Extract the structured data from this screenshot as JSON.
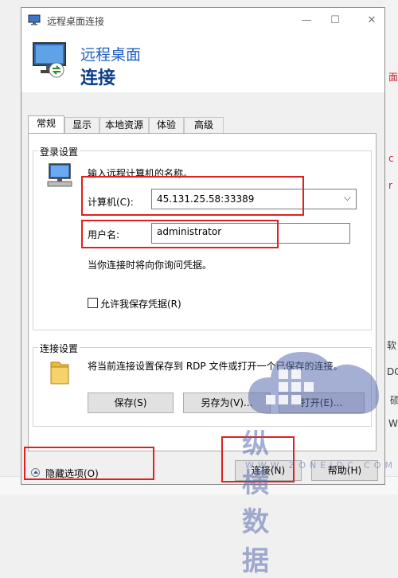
{
  "window": {
    "title": "远程桌面连接",
    "controls": {
      "minimize": "—",
      "maximize": "☐",
      "close": "✕"
    }
  },
  "header": {
    "line1": "远程桌面",
    "line2": "连接"
  },
  "tabs": [
    {
      "label": "常规",
      "active": true
    },
    {
      "label": "显示"
    },
    {
      "label": "本地资源"
    },
    {
      "label": "体验"
    },
    {
      "label": "高级"
    }
  ],
  "logon": {
    "group_title": "登录设置",
    "instruction": "输入远程计算机的名称。",
    "computer_label": "计算机(C):",
    "computer_value": "45.131.25.58:33389",
    "username_label": "用户名:",
    "username_value": "administrator",
    "prompt_note": "当你连接时将向你询问凭据。",
    "save_credentials_label": "允许我保存凭据(R)",
    "save_credentials_checked": false
  },
  "connection": {
    "group_title": "连接设置",
    "description": "将当前连接设置保存到 RDP 文件或打开一个已保存的连接。",
    "save_button": "保存(S)",
    "save_as_button": "另存为(V)...",
    "open_button": "打开(E)..."
  },
  "footer": {
    "hide_options": "隐藏选项(O)",
    "connect_button": "连接(N)",
    "help_button": "帮助(H)"
  },
  "watermark": {
    "logo": "纵横数据",
    "url": "WWW.ZONEIDC.COM"
  },
  "background_fragments": [
    "面",
    "c",
    "r",
    "软",
    "DC",
    "硕",
    "W"
  ],
  "colors": {
    "highlight_box": "#e02020",
    "header_title": "#1f5fbf",
    "watermark": "#5a6eaf"
  }
}
